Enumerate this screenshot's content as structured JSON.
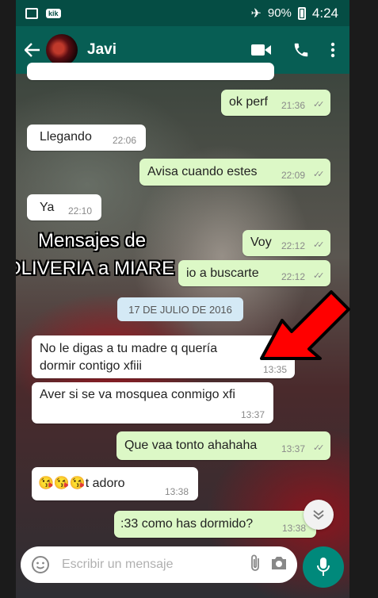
{
  "status_bar": {
    "battery": "90%",
    "time": "4:24",
    "kik_badge": "kik"
  },
  "header": {
    "contact_name": "Javi"
  },
  "messages": [
    {
      "dir": "out",
      "text": "ok perf",
      "time": "21:36"
    },
    {
      "dir": "in",
      "text": "Llegando",
      "time": "22:06"
    },
    {
      "dir": "out",
      "text": "Avisa cuando estes",
      "time": "22:09"
    },
    {
      "dir": "in",
      "text": "Ya",
      "time": "22:10"
    },
    {
      "dir": "out",
      "text": "Voy",
      "time": "22:12"
    },
    {
      "dir": "out",
      "text": "io a buscarte",
      "time": "22:12"
    },
    {
      "dir": "in",
      "text": "No le digas a tu madre q quería\ndormir contigo xfiii",
      "time": "13:35"
    },
    {
      "dir": "in",
      "text": "Aver si se va mosquea conmigo xfi",
      "time": "13:37"
    },
    {
      "dir": "out",
      "text": "Que vaa tonto ahahaha",
      "time": "13:37"
    },
    {
      "dir": "in",
      "text": "😘😘😘t adoro",
      "time": "13:38"
    },
    {
      "dir": "out",
      "text": ":33 como has dormido?",
      "time": "13:38"
    }
  ],
  "date_separator": "17 DE JULIO DE 2016",
  "overlay": {
    "line1": "Mensajes de",
    "line2": "OLIVERIA a MIARE"
  },
  "composer": {
    "placeholder": "Escribir un mensaje"
  },
  "colors": {
    "toolbar": "#075e54",
    "status_bar": "#054d44",
    "outgoing_bubble": "#dcf8c6",
    "incoming_bubble": "#ffffff",
    "mic_button": "#00897b",
    "annotation_arrow": "#ff0000"
  },
  "icons": [
    "back-arrow-icon",
    "video-call-icon",
    "phone-icon",
    "more-vert-icon",
    "emoji-icon",
    "attach-icon",
    "camera-icon",
    "mic-icon",
    "chevron-down-icon",
    "airplane-icon",
    "battery-icon",
    "image-icon"
  ]
}
